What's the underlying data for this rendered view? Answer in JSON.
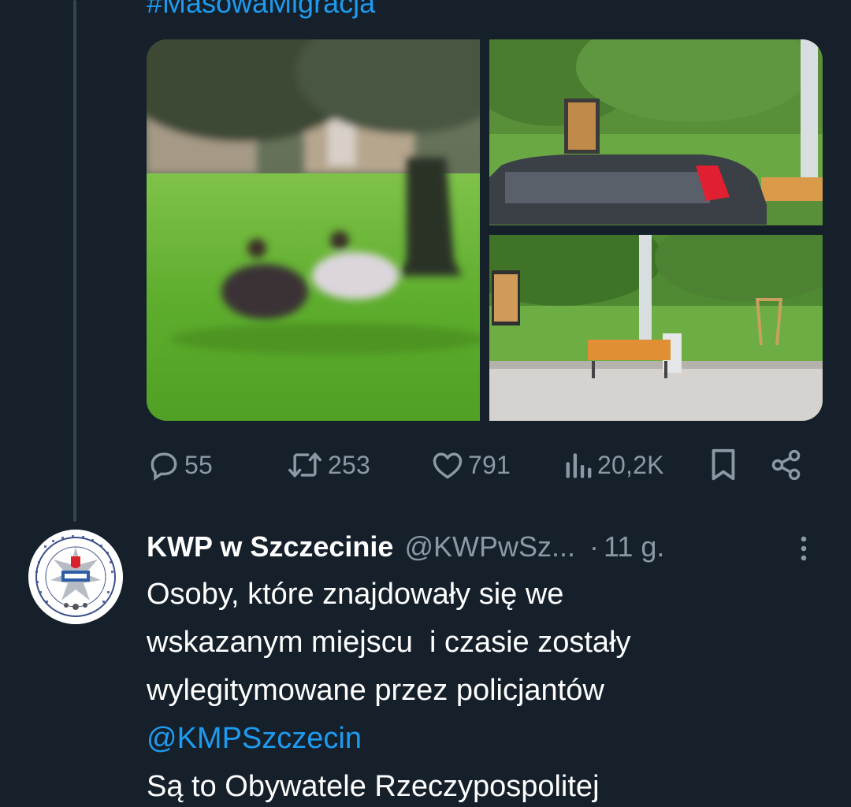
{
  "tweet_top": {
    "hashtag": "#MasowaMigracja",
    "media": [
      {
        "description": "blurry photo of people on grass under a tree"
      },
      {
        "description": "park with a passing car and an advertising pillar"
      },
      {
        "description": "park pavement with a wooden bench"
      }
    ],
    "actions": {
      "replies": "55",
      "retweets": "253",
      "likes": "791",
      "views": "20,2K"
    }
  },
  "tweet_reply": {
    "author_name": "KWP w Szczecinie",
    "author_handle": "@KWPwSz...",
    "separator": "·",
    "time": "11 g.",
    "text_lines": [
      "Osoby, które znajdowały się we",
      "wskazanym miejscu  i czasie zostały",
      "wylegitymowane przez policjantów"
    ],
    "mention": "@KMPSzczecin",
    "text_after_mention": "Są to Obywatele Rzeczypospolitej"
  },
  "icons": {
    "reply": "speech-bubble-icon",
    "retweet": "retweet-arrows-icon",
    "like": "heart-icon",
    "views": "bar-chart-icon",
    "bookmark": "bookmark-icon",
    "share": "share-nodes-icon",
    "more": "vertical-ellipsis-icon",
    "avatar": "police-badge-logo"
  },
  "colors": {
    "background": "#15202b",
    "accent": "#1d9bf0",
    "muted": "#8b98a5",
    "text": "#ffffff"
  }
}
